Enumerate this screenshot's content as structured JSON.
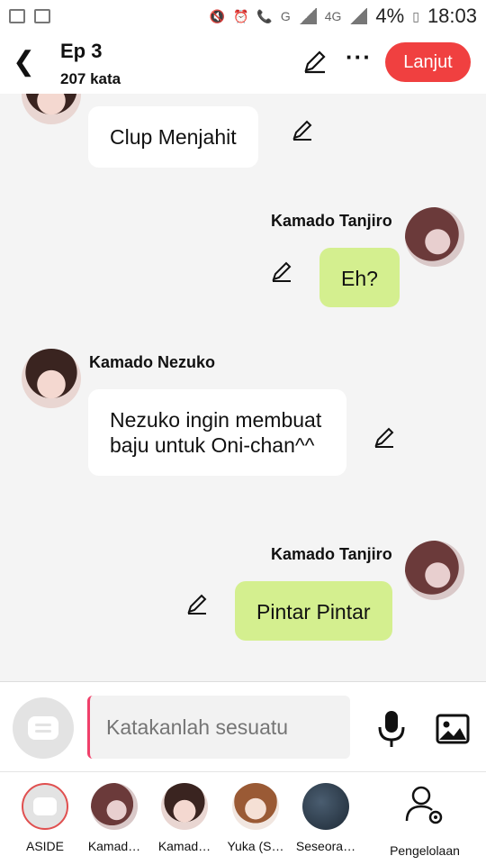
{
  "status_bar": {
    "battery": "4%",
    "time": "18:03",
    "network_left": "G",
    "network_right": "4G"
  },
  "header": {
    "title": "Ep 3",
    "subtitle": "207 kata",
    "next_button": "Lanjut"
  },
  "messages": [
    {
      "speaker": "",
      "text": "Clup Menjahit",
      "side": "left",
      "character": "nezuko"
    },
    {
      "speaker": "Kamado Tanjiro",
      "text": "Eh?",
      "side": "right",
      "character": "tanjiro"
    },
    {
      "speaker": "Kamado Nezuko",
      "text": "Nezuko ingin membuat baju untuk Oni-chan^^",
      "side": "left",
      "character": "nezuko"
    },
    {
      "speaker": "Kamado Tanjiro",
      "text": "Pintar Pintar",
      "side": "right",
      "character": "tanjiro"
    }
  ],
  "composer": {
    "placeholder": "Katakanlah sesuatu"
  },
  "characters": [
    {
      "label": "ASIDE",
      "avatar": "aside"
    },
    {
      "label": "Kamad…",
      "avatar": "tanjiro"
    },
    {
      "label": "Kamad…",
      "avatar": "nezuko"
    },
    {
      "label": "Yuka (S…",
      "avatar": "yuka"
    },
    {
      "label": "Seseora…",
      "avatar": "seseora"
    },
    {
      "label": "Pengelolaan",
      "avatar": "manage-icon"
    }
  ],
  "colors": {
    "accent": "#f04040",
    "right_bubble": "#d4ef8f",
    "left_bubble": "#ffffff"
  }
}
